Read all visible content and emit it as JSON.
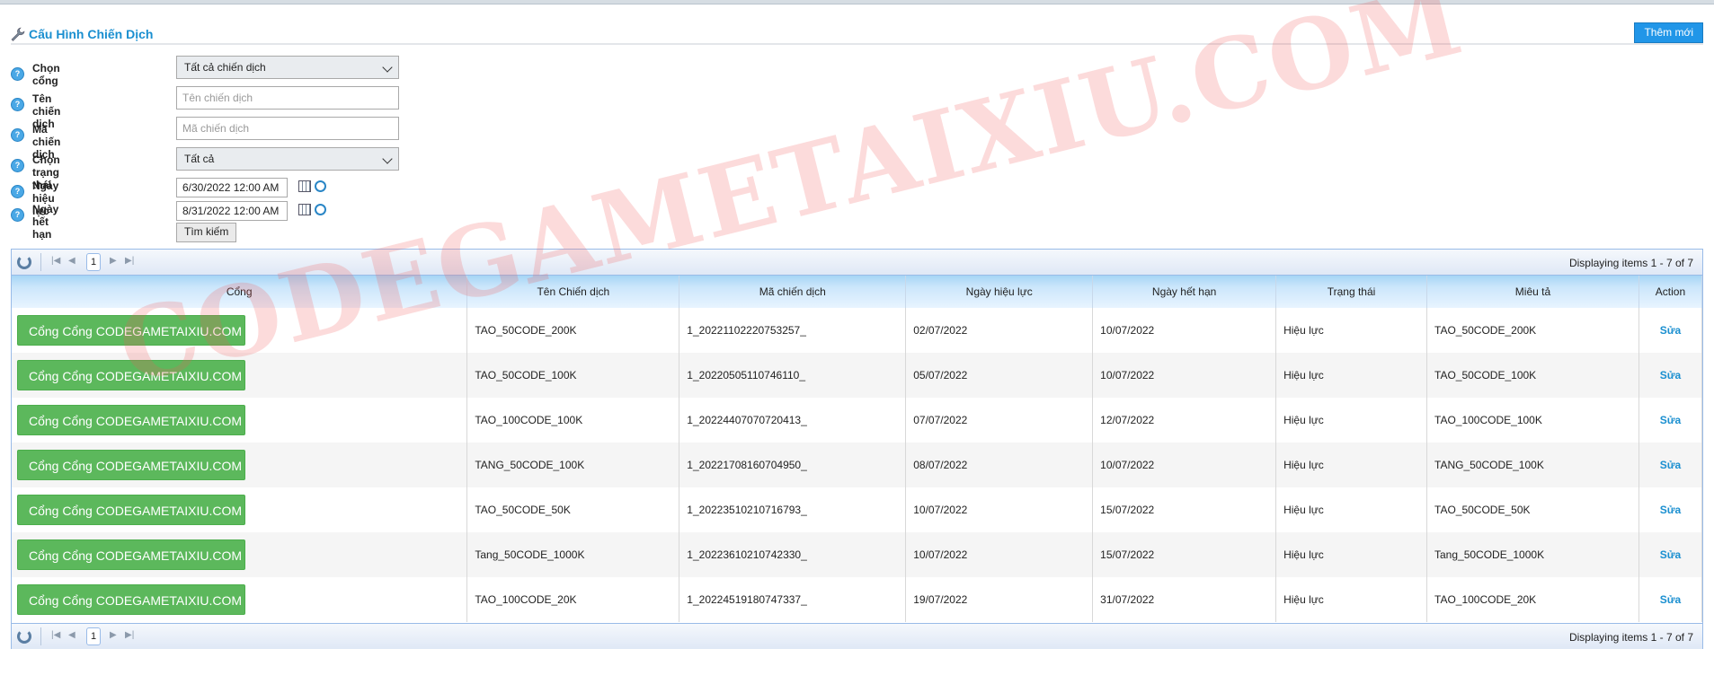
{
  "page": {
    "title": "Cấu Hình Chiến Dịch",
    "add_button": "Thêm mới"
  },
  "form": {
    "gate_label": "Chọn cổng",
    "gate_value": "Tất cả chiến dịch",
    "name_label": "Tên chiến dịch",
    "name_placeholder": "Tên chiến dịch",
    "code_label": "Mã chiến dịch",
    "code_placeholder": "Mã chiến dịch",
    "status_label": "Chọn trạng thái",
    "status_value": "Tất cả",
    "start_label": "Ngày hiệu lực",
    "start_value": "6/30/2022 12:00 AM",
    "end_label": "Ngày hết hạn",
    "end_value": "8/31/2022 12:00 AM",
    "search_button": "Tìm kiếm"
  },
  "pager": {
    "page": "1",
    "display": "Displaying items 1 - 7 of 7"
  },
  "table": {
    "headers": [
      "Cổng",
      "Tên Chiến dịch",
      "Mã chiến dịch",
      "Ngày hiệu lực",
      "Ngày hết hạn",
      "Trạng thái",
      "Miêu tả",
      "Action"
    ],
    "rows": [
      {
        "gate": "Cổng Cổng CODEGAMETAIXIU.COM",
        "name": "TAO_50CODE_200K",
        "code": "1_20221102220753257_",
        "start": "02/07/2022",
        "end": "10/07/2022",
        "status": "Hiệu lực",
        "desc": "TAO_50CODE_200K",
        "action": "Sửa"
      },
      {
        "gate": "Cổng Cổng CODEGAMETAIXIU.COM",
        "name": "TAO_50CODE_100K",
        "code": "1_20220505110746110_",
        "start": "05/07/2022",
        "end": "10/07/2022",
        "status": "Hiệu lực",
        "desc": "TAO_50CODE_100K",
        "action": "Sửa"
      },
      {
        "gate": "Cổng Cổng CODEGAMETAIXIU.COM",
        "name": "TAO_100CODE_100K",
        "code": "1_20224407070720413_",
        "start": "07/07/2022",
        "end": "12/07/2022",
        "status": "Hiệu lực",
        "desc": "TAO_100CODE_100K",
        "action": "Sửa"
      },
      {
        "gate": "Cổng Cổng CODEGAMETAIXIU.COM",
        "name": "TANG_50CODE_100K",
        "code": "1_20221708160704950_",
        "start": "08/07/2022",
        "end": "10/07/2022",
        "status": "Hiệu lực",
        "desc": "TANG_50CODE_100K",
        "action": "Sửa"
      },
      {
        "gate": "Cổng Cổng CODEGAMETAIXIU.COM",
        "name": "TAO_50CODE_50K",
        "code": "1_20223510210716793_",
        "start": "10/07/2022",
        "end": "15/07/2022",
        "status": "Hiệu lực",
        "desc": "TAO_50CODE_50K",
        "action": "Sửa"
      },
      {
        "gate": "Cổng Cổng CODEGAMETAIXIU.COM",
        "name": "Tang_50CODE_1000K",
        "code": "1_20223610210742330_",
        "start": "10/07/2022",
        "end": "15/07/2022",
        "status": "Hiệu lực",
        "desc": "Tang_50CODE_1000K",
        "action": "Sửa"
      },
      {
        "gate": "Cổng Cổng CODEGAMETAIXIU.COM",
        "name": "TAO_100CODE_20K",
        "code": "1_20224519180747337_",
        "start": "19/07/2022",
        "end": "31/07/2022",
        "status": "Hiệu lực",
        "desc": "TAO_100CODE_20K",
        "action": "Sửa"
      }
    ]
  },
  "watermark": "CODEGAMETAIXIU.COM"
}
